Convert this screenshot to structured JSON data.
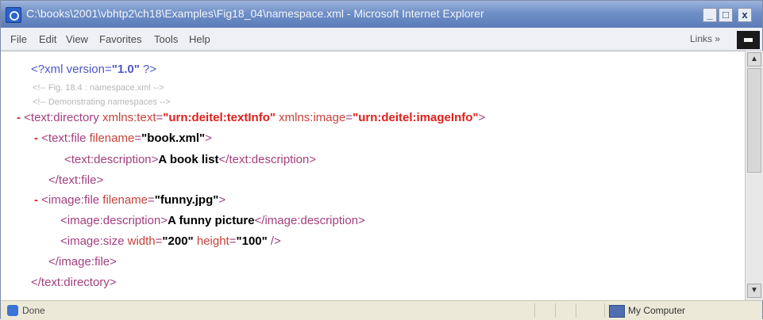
{
  "window": {
    "title": "C:\\books\\2001\\vbhtp2\\ch18\\Examples\\Fig18_04\\namespace.xml - Microsoft Internet Explorer",
    "controls": {
      "minimize": "_",
      "maximize": "□",
      "close": "x"
    }
  },
  "menubar": {
    "items": [
      "File",
      "Edit",
      "View",
      "Favorites",
      "Tools",
      "Help"
    ],
    "links_label": "Links »"
  },
  "content": {
    "line1": {
      "open": "<?",
      "name": "xml",
      "attr": "version",
      "eq": "=",
      "value": "\"1.0\"",
      "close": " ?>"
    },
    "comment1": "<!-- Fig. 18.4 : namespace.xml -->",
    "comment2": "<!-- Demonstrating namespaces -->",
    "directory": {
      "toggle": "-",
      "tag_open": " <text:directory ",
      "attr1": "xmlns:text",
      "eq": "=",
      "val1": "\"urn:deitel:textInfo\"",
      "attr2": "xmlns:image",
      "val2": "\"urn:deitel:imageInfo\"",
      "tag_close": ">"
    },
    "textfile": {
      "toggle": "-",
      "tag_open": " <text:file ",
      "attr": "filename",
      "eq": "=",
      "val": "\"book.xml\"",
      "tag_close": ">"
    },
    "textdesc": {
      "open": "<text:description>",
      "text": "A book list",
      "close": "</text:description>"
    },
    "textfile_close": "</text:file>",
    "imagefile": {
      "toggle": "-",
      "tag_open": " <image:file ",
      "attr": "filename",
      "eq": "=",
      "val": "\"funny.jpg\"",
      "tag_close": ">"
    },
    "imagedesc": {
      "open": "<image:description>",
      "text": "A funny picture",
      "close": "</image:description>"
    },
    "imagesize": {
      "tag_open": "<image:size ",
      "attr1": "width",
      "eq": "=",
      "val1": "\"200\"",
      "attr2": "height",
      "val2": "\"100\"",
      "tag_close": " />"
    },
    "imagefile_close": "</image:file>",
    "directory_close": "</text:directory>"
  },
  "statusbar": {
    "status": "Done",
    "zone": "My Computer"
  },
  "colors": {
    "tag": "#a23f7e",
    "attr": "#c5423a",
    "value": "#e0201b",
    "pi": "#4d57c8",
    "comment": "#b6b6b6"
  }
}
